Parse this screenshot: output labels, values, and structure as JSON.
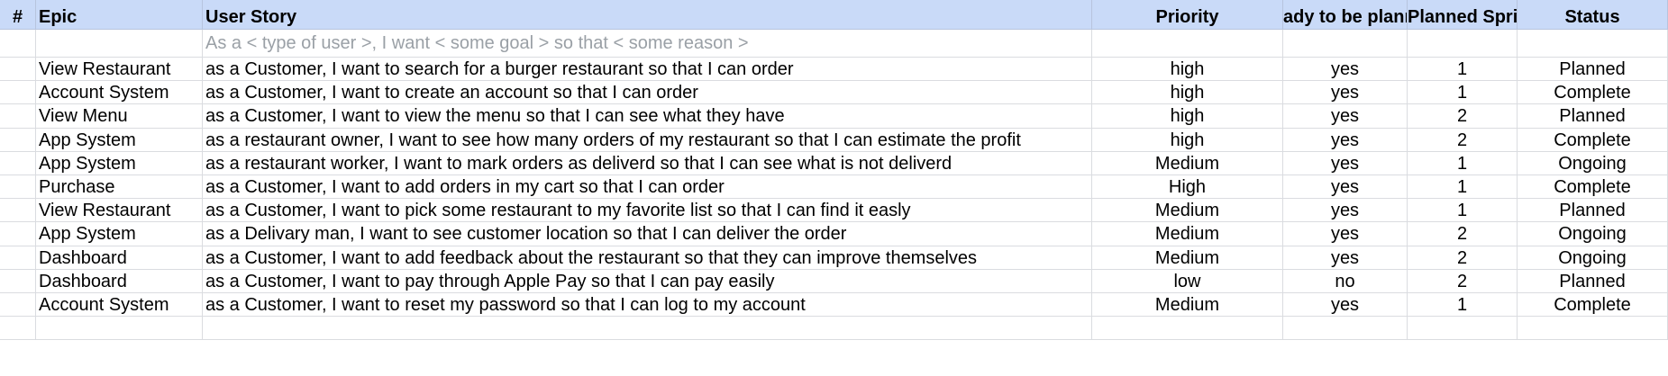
{
  "header": {
    "num": "#",
    "epic": "Epic",
    "story": "User Story",
    "priority": "Priority",
    "ready": "ady to be plann",
    "sprint": "Planned Sprin",
    "status": "Status"
  },
  "placeholder_story": "As a < type of user >, I want < some goal > so that < some reason >",
  "rows": [
    {
      "epic": "View Restaurant",
      "story": "as a Customer, I want to search for a burger restaurant so that I can order",
      "priority": "high",
      "ready": "yes",
      "sprint": "1",
      "status": "Planned"
    },
    {
      "epic": "Account System",
      "story": "as a Customer, I want to create an account so that I can order",
      "priority": "high",
      "ready": "yes",
      "sprint": "1",
      "status": "Complete"
    },
    {
      "epic": "View Menu",
      "story": "as a Customer, I want to view the menu so that I can see what they have",
      "priority": "high",
      "ready": "yes",
      "sprint": "2",
      "status": "Planned"
    },
    {
      "epic": "App System",
      "story": "as a restaurant owner, I want to see how many orders of my restaurant so that I can estimate the profit",
      "priority": "high",
      "ready": "yes",
      "sprint": "2",
      "status": "Complete"
    },
    {
      "epic": "App System",
      "story": "as a restaurant worker, I want to mark orders as deliverd so that I can see what is not deliverd",
      "priority": "Medium",
      "ready": "yes",
      "sprint": "1",
      "status": "Ongoing"
    },
    {
      "epic": "Purchase",
      "story": "as a Customer, I want to add orders in my cart so that I can order",
      "priority": "High",
      "ready": "yes",
      "sprint": "1",
      "status": "Complete"
    },
    {
      "epic": "View Restaurant",
      "story": "as a Customer, I want to pick some restaurant to my favorite list so that I can find it easly",
      "priority": "Medium",
      "ready": "yes",
      "sprint": "1",
      "status": "Planned"
    },
    {
      "epic": "App System",
      "story": "as a Delivary man, I want to see customer location so that I can deliver the order",
      "priority": "Medium",
      "ready": "yes",
      "sprint": "2",
      "status": "Ongoing"
    },
    {
      "epic": "Dashboard",
      "story": "as a Customer, I want to add feedback about the restaurant so that they can improve themselves",
      "priority": "Medium",
      "ready": "yes",
      "sprint": "2",
      "status": "Ongoing"
    },
    {
      "epic": "Dashboard",
      "story": "as a Customer, I want to pay through Apple Pay so that I can pay easily",
      "priority": "low",
      "ready": "no",
      "sprint": "2",
      "status": "Planned"
    },
    {
      "epic": "Account System",
      "story": "as a Customer, I want to reset my password so that I can log to my account",
      "priority": "Medium",
      "ready": "yes",
      "sprint": "1",
      "status": "Complete"
    }
  ]
}
